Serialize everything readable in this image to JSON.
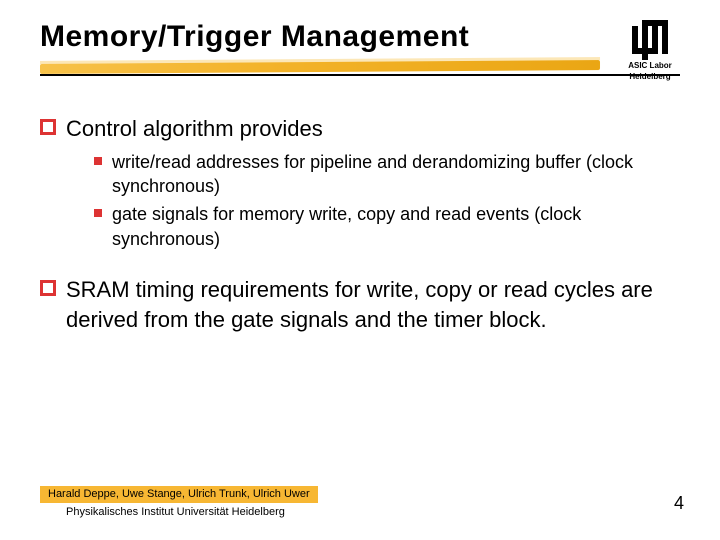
{
  "header": {
    "title": "Memory/Trigger Management",
    "logo": {
      "line1": "ASIC Labor",
      "line2": "Heidelberg"
    }
  },
  "content": {
    "items": [
      {
        "text": "Control algorithm provides",
        "sub": [
          "write/read addresses for pipeline and derandomizing buffer (clock synchronous)",
          "gate signals for memory write, copy and read events (clock synchronous)"
        ]
      },
      {
        "text": "SRAM timing requirements for write, copy or read cycles are derived from the gate signals and the timer block.",
        "sub": []
      }
    ]
  },
  "footer": {
    "authors": "Harald Deppe, Uwe Stange, Ulrich Trunk, Ulrich Uwer",
    "institution": "Physikalisches Institut Universität Heidelberg",
    "page": "4"
  }
}
